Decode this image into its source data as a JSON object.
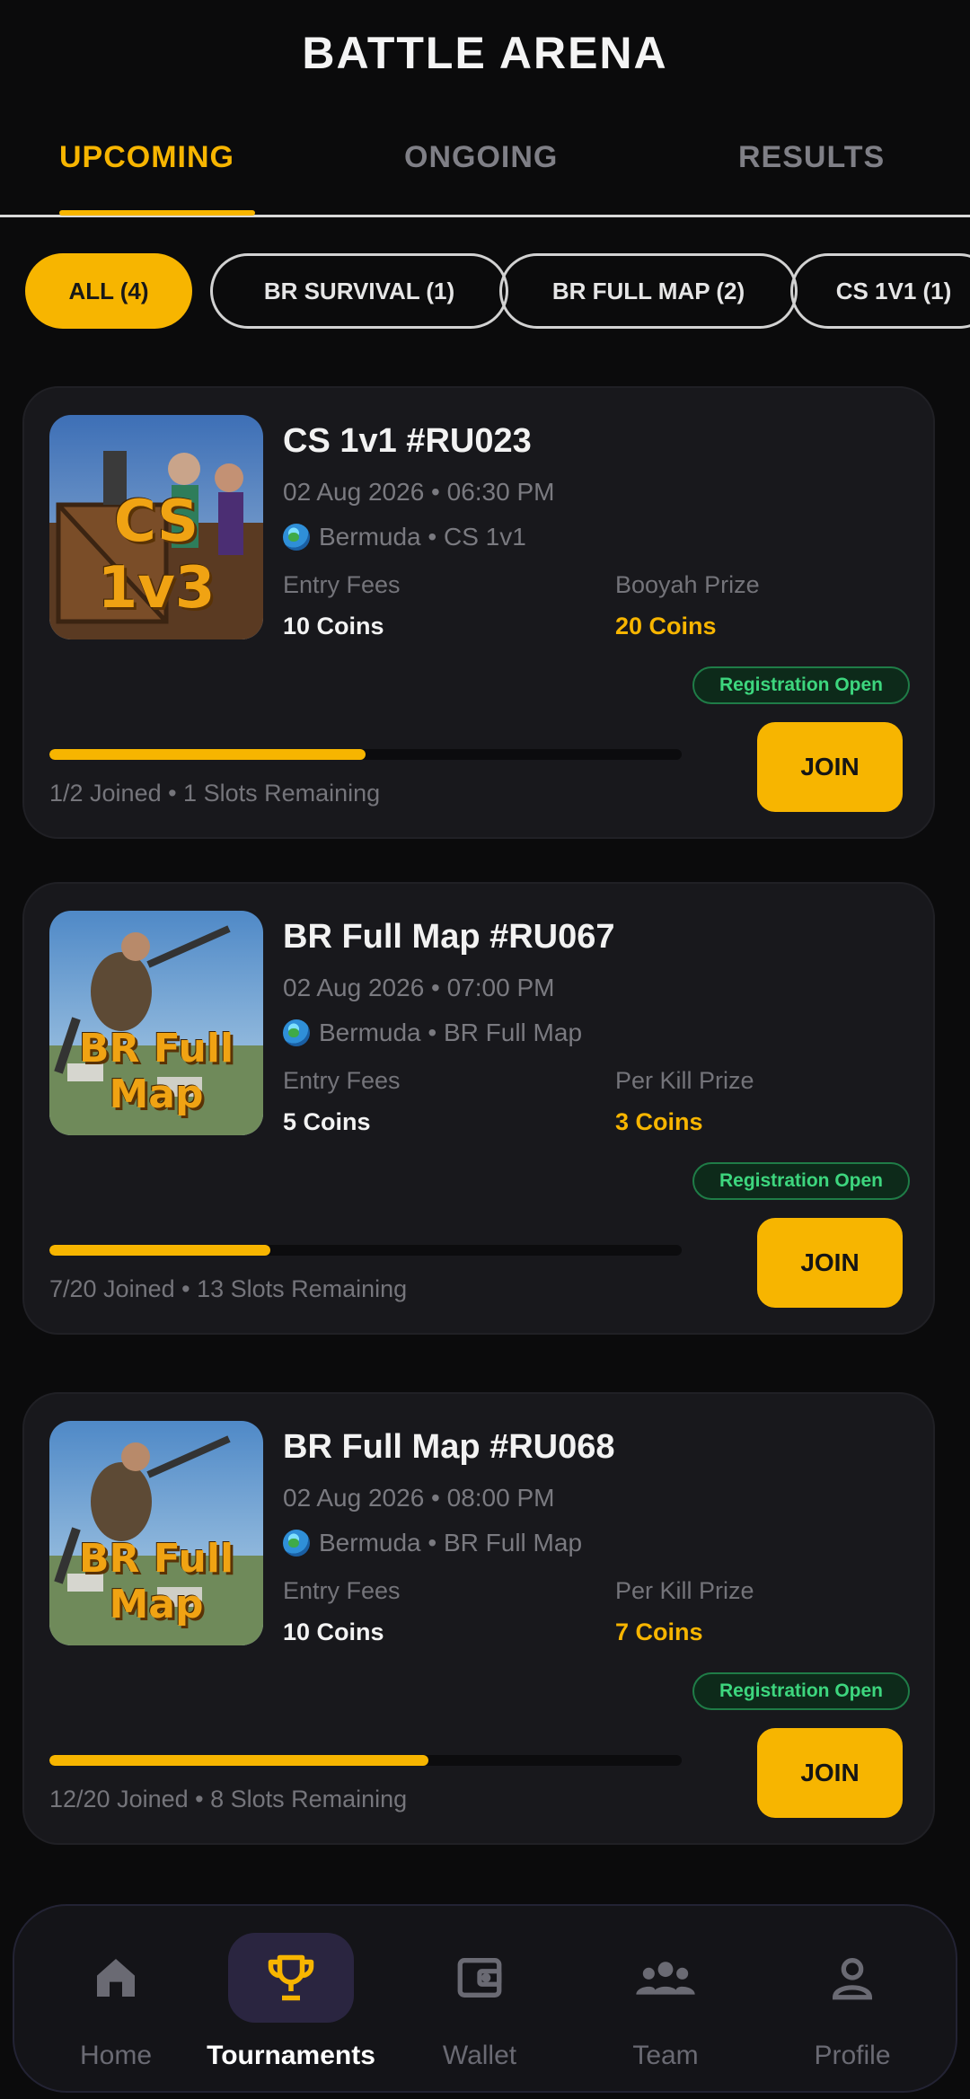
{
  "header": {
    "title": "BATTLE ARENA"
  },
  "tabs": [
    {
      "label": "UPCOMING"
    },
    {
      "label": "ONGOING"
    },
    {
      "label": "RESULTS"
    }
  ],
  "filters": [
    {
      "label": "ALL (4)"
    },
    {
      "label": "BR SURVIVAL  (1)"
    },
    {
      "label": "BR FULL MAP  (2)"
    },
    {
      "label": "CS 1V1  (1)"
    }
  ],
  "colors": {
    "accent": "#f7b500",
    "background": "#0b0b0c",
    "card": "#18181c",
    "status_green": "#3dd67e"
  },
  "matches": [
    {
      "thumb_text": "CS 1v3",
      "title": "CS 1v1 #RU023",
      "datetime": "02 Aug 2026 • 06:30 PM",
      "map": "Bermuda • CS 1v1",
      "entry_label": "Entry Fees",
      "entry_value": "10 Coins",
      "prize_label": "Booyah Prize",
      "prize_value": "20 Coins",
      "status": "Registration Open",
      "join_label": "JOIN",
      "progress": 0.5,
      "joined_text": "1/2 Joined  •  1 Slots Remaining"
    },
    {
      "thumb_text": "BR Full Map",
      "title": "BR Full Map #RU067",
      "datetime": "02 Aug 2026 • 07:00 PM",
      "map": "Bermuda  • BR Full Map",
      "entry_label": "Entry Fees",
      "entry_value": "5 Coins",
      "prize_label": "Per Kill Prize",
      "prize_value": "3 Coins",
      "status": "Registration Open",
      "join_label": "JOIN",
      "progress": 0.35,
      "joined_text": "7/20 Joined  •  13 Slots Remaining"
    },
    {
      "thumb_text": "BR Full Map",
      "title": "BR Full Map #RU068",
      "datetime": "02 Aug 2026 • 08:00 PM",
      "map": "Bermuda  • BR Full Map",
      "entry_label": "Entry Fees",
      "entry_value": "10 Coins",
      "prize_label": "Per Kill Prize",
      "prize_value": "7 Coins",
      "status": "Registration Open",
      "join_label": "JOIN",
      "progress": 0.6,
      "joined_text": "12/20 Joined  •  8 Slots Remaining"
    }
  ],
  "nav": [
    {
      "label": "Home",
      "icon": "home-icon"
    },
    {
      "label": "Tournaments",
      "icon": "trophy-icon"
    },
    {
      "label": "Wallet",
      "icon": "wallet-icon"
    },
    {
      "label": "Team",
      "icon": "team-icon"
    },
    {
      "label": "Profile",
      "icon": "profile-icon"
    }
  ]
}
